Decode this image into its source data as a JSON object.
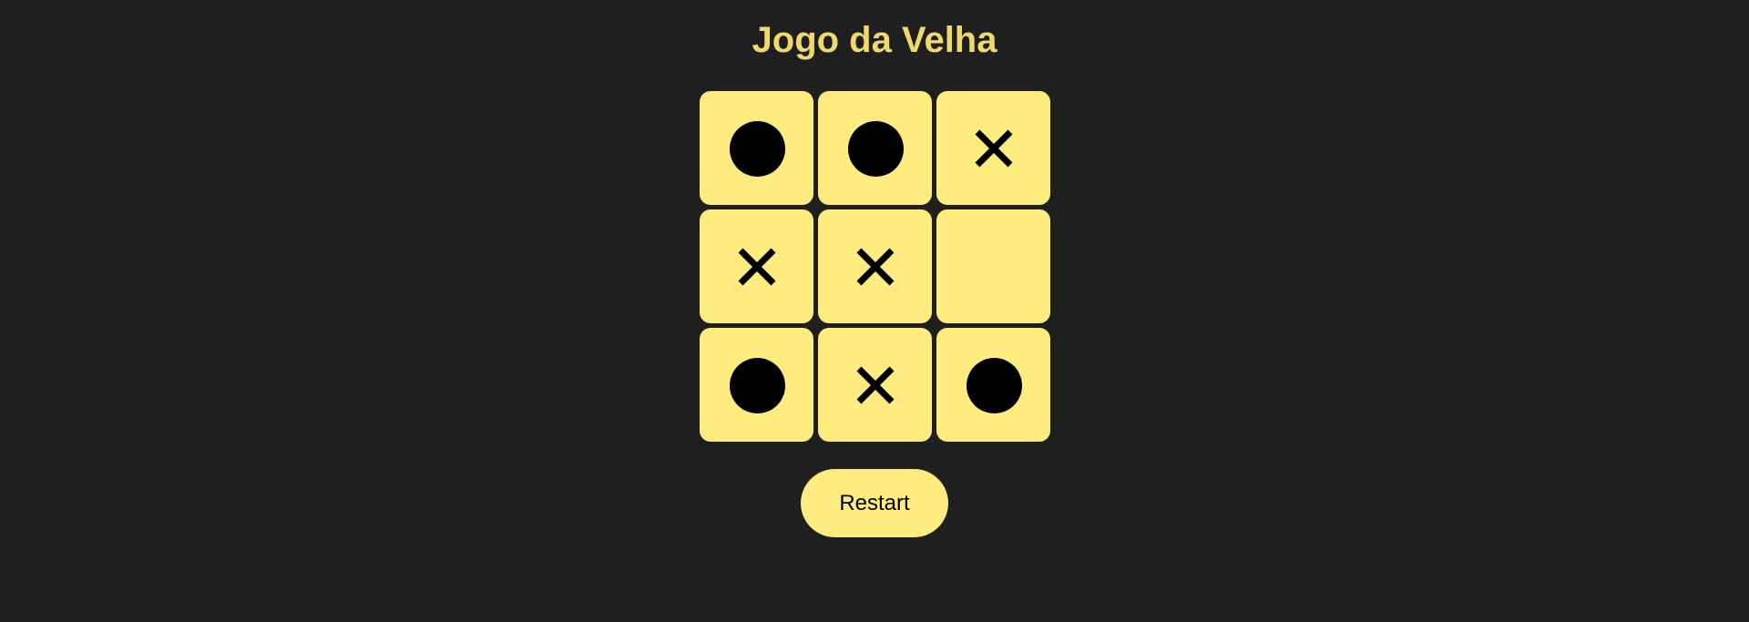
{
  "title": "Jogo da Velha",
  "board": [
    "O",
    "O",
    "X",
    "X",
    "X",
    "",
    "O",
    "X",
    "O"
  ],
  "restart_label": "Restart",
  "colors": {
    "background": "#1f1f1f",
    "cell": "#ffec80",
    "title": "#efd96c",
    "mark": "#000000"
  }
}
